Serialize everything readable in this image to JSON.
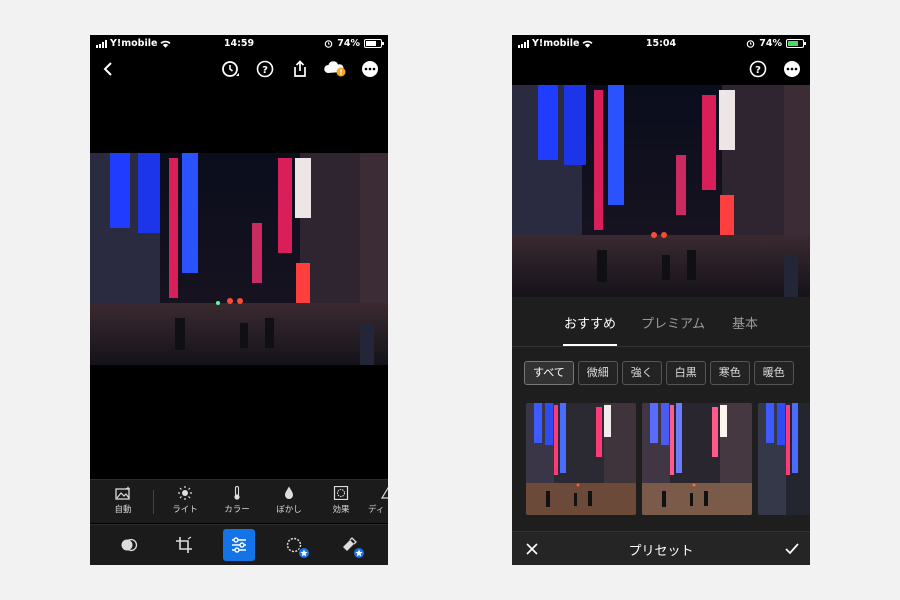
{
  "left_screen": {
    "status": {
      "carrier": "Y!mobile",
      "time": "14:59",
      "battery": "74%"
    },
    "top_icons": [
      "back-arrow-icon",
      "history-icon",
      "help-icon",
      "share-icon",
      "cloud-warning-icon",
      "more-icon"
    ],
    "adjust_tools": [
      {
        "label": "自動",
        "icon": "auto-icon"
      },
      {
        "label": "ライト",
        "icon": "light-icon"
      },
      {
        "label": "カラー",
        "icon": "color-icon"
      },
      {
        "label": "ぼかし",
        "icon": "blur-icon"
      },
      {
        "label": "効果",
        "icon": "effects-icon"
      },
      {
        "label": "ディ",
        "icon": "detail-icon"
      }
    ],
    "modes": [
      {
        "icon": "presets-icon",
        "active": false,
        "premium": false
      },
      {
        "icon": "crop-icon",
        "active": false,
        "premium": false
      },
      {
        "icon": "edit-sliders-icon",
        "active": true,
        "premium": false
      },
      {
        "icon": "selective-icon",
        "active": false,
        "premium": true
      },
      {
        "icon": "healing-icon",
        "active": false,
        "premium": true
      }
    ]
  },
  "right_screen": {
    "status": {
      "carrier": "Y!mobile",
      "time": "15:04",
      "battery": "74%"
    },
    "top_icons": [
      "help-icon",
      "more-icon"
    ],
    "tabs": [
      {
        "label": "おすすめ",
        "active": true
      },
      {
        "label": "プレミアム",
        "active": false
      },
      {
        "label": "基本",
        "active": false
      }
    ],
    "chips": [
      {
        "label": "すべて",
        "active": true
      },
      {
        "label": "微細",
        "active": false
      },
      {
        "label": "強く",
        "active": false
      },
      {
        "label": "白黒",
        "active": false
      },
      {
        "label": "寒色",
        "active": false
      },
      {
        "label": "暖色",
        "active": false
      }
    ],
    "footer": {
      "title": "プリセット",
      "cancel_icon": "close-icon",
      "confirm_icon": "checkmark-icon"
    }
  },
  "colors": {
    "accent": "#1473e6",
    "background": "#f2f2f2",
    "panel": "#1e1e1e",
    "charging": "#4cd964",
    "warning": "#f5a623"
  }
}
